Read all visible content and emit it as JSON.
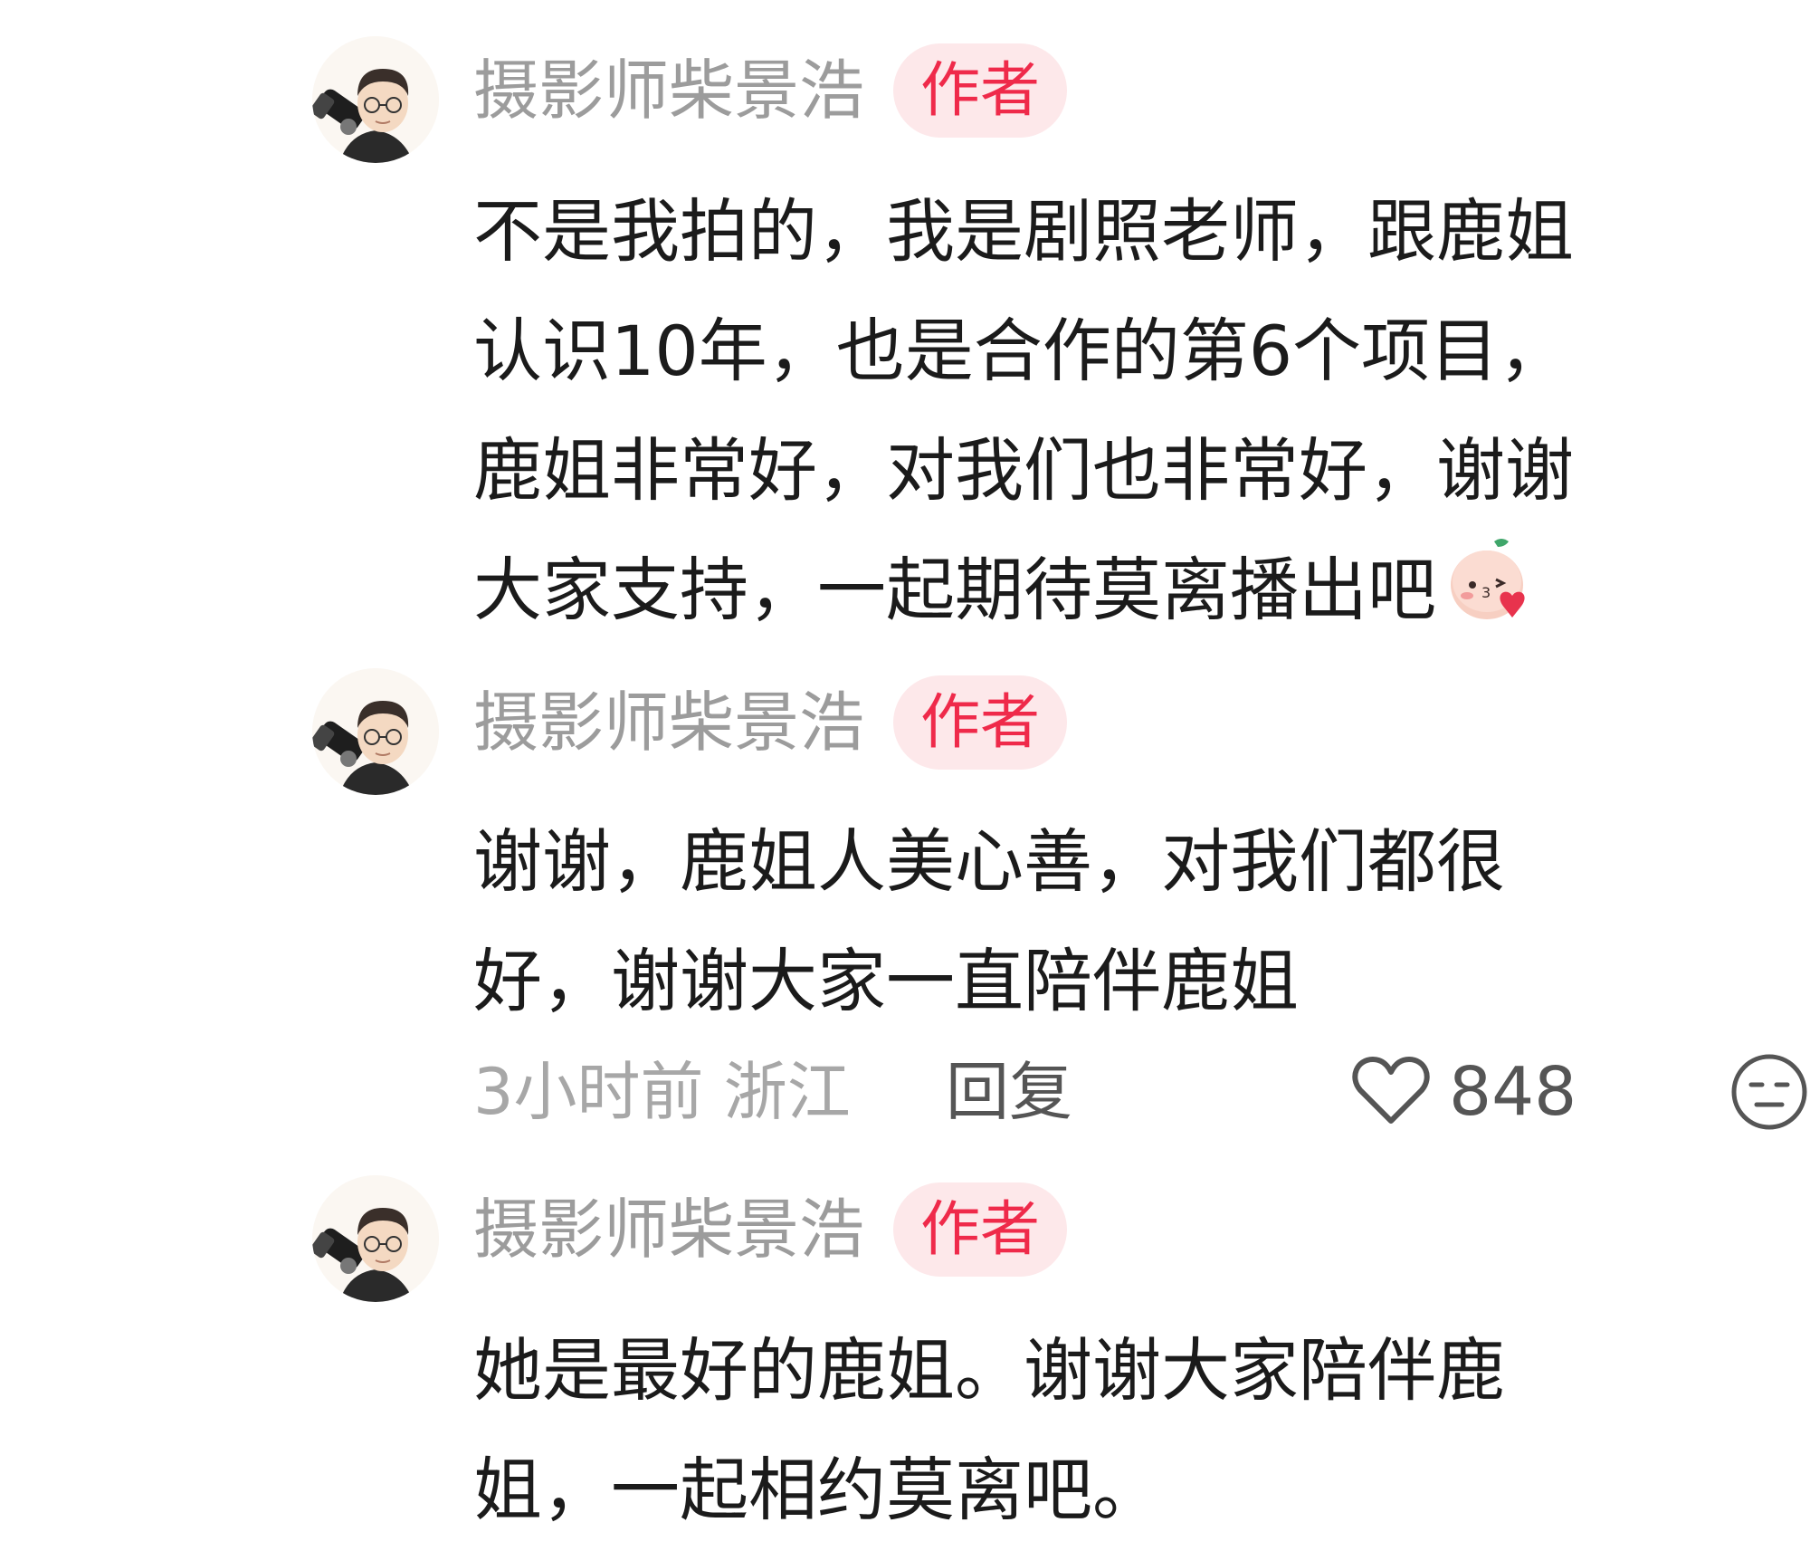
{
  "comments": [
    {
      "username": "摄影师柴景浩",
      "badge": "作者",
      "text": "不是我拍的，我是剧照老师，跟鹿姐\n认识10年，也是合作的第6个项目，\n鹿姐非常好，对我们也非常好，谢谢\n大家支持，一起期待莫离播出吧",
      "emoji": "blush-heart-emoji"
    },
    {
      "username": "摄影师柴景浩",
      "badge": "作者",
      "text": "谢谢，鹿姐人美心善，对我们都很\n好，谢谢大家一直陪伴鹿姐",
      "meta": {
        "time_location": "3小时前 浙江",
        "reply": "回复",
        "likes": "848",
        "like_icon": "heart-icon",
        "dislike_icon": "unhappy-face-icon"
      }
    },
    {
      "username": "摄影师柴景浩",
      "badge": "作者",
      "text": "她是最好的鹿姐。谢谢大家陪伴鹿\n姐，一起相约莫离吧。"
    }
  ],
  "colors": {
    "username": "#9c9c9c",
    "badge_bg": "#fde8ea",
    "badge_text": "#ef2a4a",
    "body_text": "#1b1b1b",
    "meta_text": "#a7a7a7"
  }
}
